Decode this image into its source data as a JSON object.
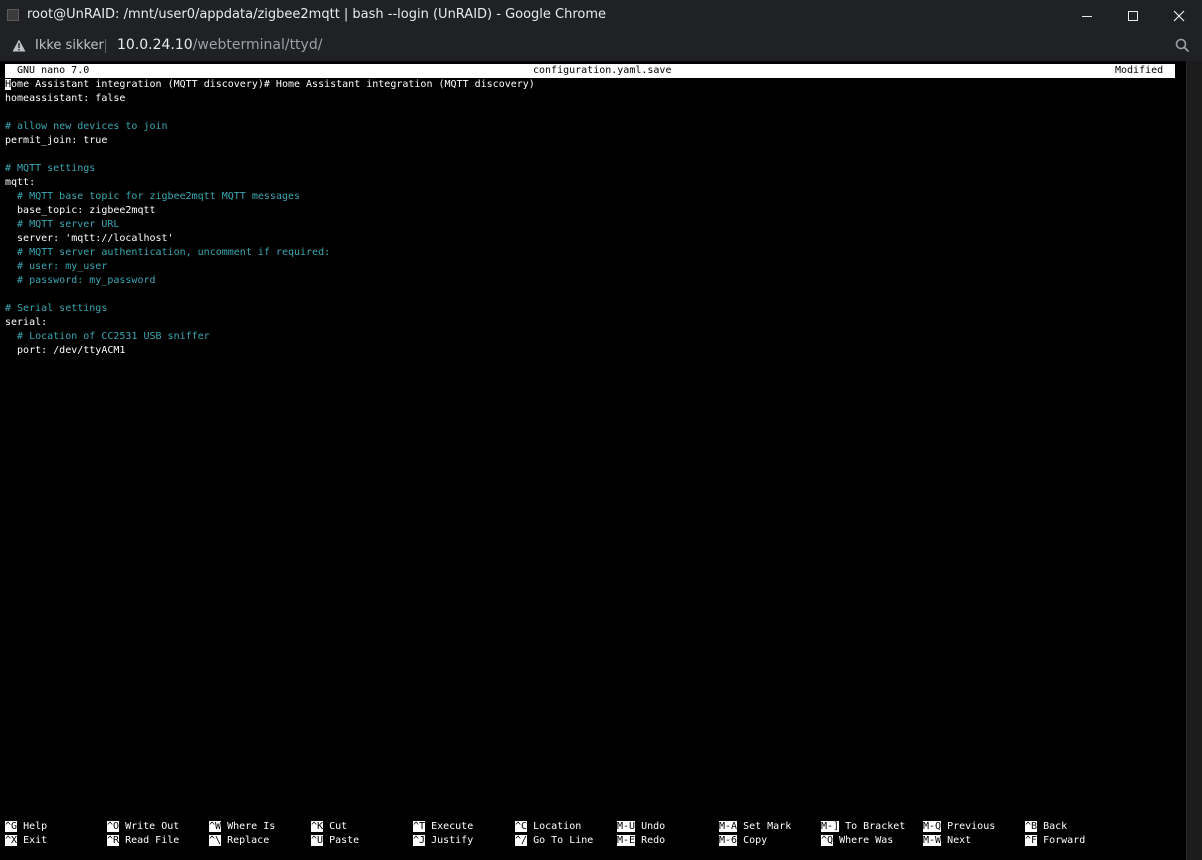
{
  "window": {
    "title": "root@UnRAID: /mnt/user0/appdata/zigbee2mqtt | bash --login (UnRAID) - Google Chrome"
  },
  "address_bar": {
    "security_label": "Ikke sikker",
    "url_host": "10.0.24.10",
    "url_path": "/webterminal/ttyd/"
  },
  "nano": {
    "version": "GNU nano 7.0",
    "filename": "configuration.yaml.save",
    "status": "Modified",
    "first_line_cursor_char": "H",
    "lines": [
      {
        "text": "ome Assistant integration (MQTT discovery)# Home Assistant integration (MQTT discovery)",
        "comment": false
      },
      {
        "text": "homeassistant: false",
        "comment": false
      },
      {
        "text": "",
        "comment": false
      },
      {
        "text": "# allow new devices to join",
        "comment": true
      },
      {
        "text": "permit_join: true",
        "comment": false
      },
      {
        "text": "",
        "comment": false
      },
      {
        "text": "# MQTT settings",
        "comment": true
      },
      {
        "text": "mqtt:",
        "comment": false
      },
      {
        "text": "  # MQTT base topic for zigbee2mqtt MQTT messages",
        "comment": true
      },
      {
        "text": "  base_topic: zigbee2mqtt",
        "comment": false
      },
      {
        "text": "  # MQTT server URL",
        "comment": true
      },
      {
        "text": "  server: 'mqtt://localhost'",
        "comment": false
      },
      {
        "text": "  # MQTT server authentication, uncomment if required:",
        "comment": true
      },
      {
        "text": "  # user: my_user",
        "comment": true
      },
      {
        "text": "  # password: my_password",
        "comment": true
      },
      {
        "text": "",
        "comment": false
      },
      {
        "text": "# Serial settings",
        "comment": true
      },
      {
        "text": "serial:",
        "comment": false
      },
      {
        "text": "  # Location of CC2531 USB sniffer",
        "comment": true
      },
      {
        "text": "  port: /dev/ttyACM1",
        "comment": false
      }
    ],
    "shortcuts": [
      [
        {
          "key": "^G",
          "label": "Help"
        },
        {
          "key": "^O",
          "label": "Write Out"
        },
        {
          "key": "^W",
          "label": "Where Is"
        },
        {
          "key": "^K",
          "label": "Cut"
        },
        {
          "key": "^T",
          "label": "Execute"
        },
        {
          "key": "^C",
          "label": "Location"
        },
        {
          "key": "M-U",
          "label": "Undo"
        },
        {
          "key": "M-A",
          "label": "Set Mark"
        },
        {
          "key": "M-]",
          "label": "To Bracket"
        },
        {
          "key": "M-Q",
          "label": "Previous"
        },
        {
          "key": "^B",
          "label": "Back"
        }
      ],
      [
        {
          "key": "^X",
          "label": "Exit"
        },
        {
          "key": "^R",
          "label": "Read File"
        },
        {
          "key": "^\\",
          "label": "Replace"
        },
        {
          "key": "^U",
          "label": "Paste"
        },
        {
          "key": "^J",
          "label": "Justify"
        },
        {
          "key": "^/",
          "label": "Go To Line"
        },
        {
          "key": "M-E",
          "label": "Redo"
        },
        {
          "key": "M-6",
          "label": "Copy"
        },
        {
          "key": "^Q",
          "label": "Where Was"
        },
        {
          "key": "M-W",
          "label": "Next"
        },
        {
          "key": "^F",
          "label": "Forward"
        }
      ]
    ]
  },
  "colors": {
    "comment": "#3aa7b3",
    "text": "#ffffff",
    "background": "#000000",
    "chrome_bar": "#202124"
  },
  "icons": {
    "security": "warning-triangle-icon",
    "zoom": "magnifier-icon"
  }
}
